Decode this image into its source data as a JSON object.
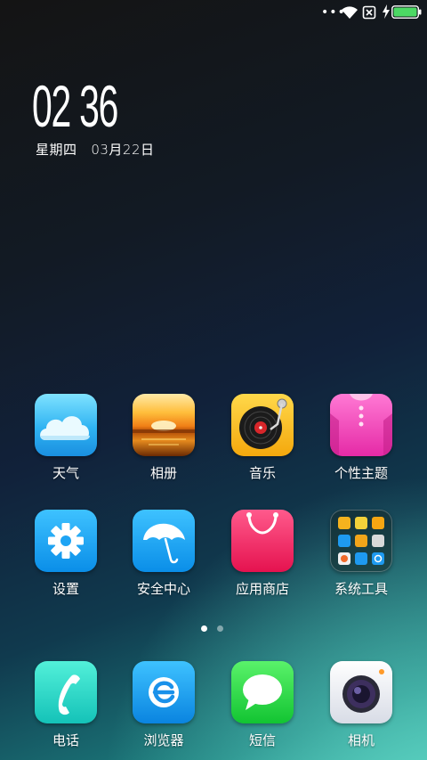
{
  "status_bar": {
    "more_glyph": "•••",
    "icons": [
      "more-icon",
      "wifi-icon",
      "no-sim-icon",
      "charging-icon",
      "battery-icon"
    ],
    "battery_level": 1.0,
    "battery_color": "#4cd964"
  },
  "clock": {
    "time": "02 36",
    "weekday": "星期四",
    "date": "03月22日"
  },
  "apps": [
    {
      "label": "天气",
      "icon": "weather-icon"
    },
    {
      "label": "相册",
      "icon": "gallery-icon"
    },
    {
      "label": "音乐",
      "icon": "music-icon"
    },
    {
      "label": "个性主题",
      "icon": "themes-icon"
    },
    {
      "label": "设置",
      "icon": "settings-icon"
    },
    {
      "label": "安全中心",
      "icon": "security-icon"
    },
    {
      "label": "应用商店",
      "icon": "app-store-icon"
    },
    {
      "label": "系统工具",
      "icon": "system-tools-folder-icon"
    }
  ],
  "page_indicator": {
    "pages": 2,
    "active": 0
  },
  "dock": [
    {
      "label": "电话",
      "icon": "phone-icon"
    },
    {
      "label": "浏览器",
      "icon": "browser-icon"
    },
    {
      "label": "短信",
      "icon": "messages-icon"
    },
    {
      "label": "相机",
      "icon": "camera-icon"
    }
  ]
}
